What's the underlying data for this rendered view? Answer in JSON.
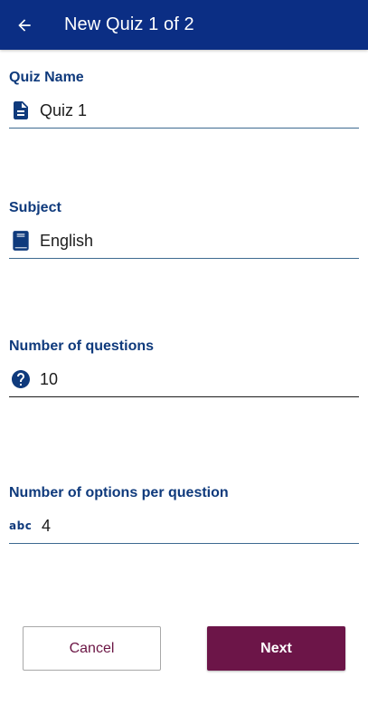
{
  "appbar": {
    "title": "New Quiz 1 of 2",
    "back_icon": "arrow-left-icon"
  },
  "fields": {
    "quiz_name": {
      "label": "Quiz Name",
      "value": "Quiz 1",
      "icon": "document-icon"
    },
    "subject": {
      "label": "Subject",
      "value": "English",
      "icon": "book-icon"
    },
    "num_questions": {
      "label": "Number of questions",
      "value": "10",
      "icon": "question-circle-icon"
    },
    "num_options": {
      "label": "Number of options per question",
      "value": "4",
      "icon": "abc-icon",
      "icon_text": "abc"
    }
  },
  "buttons": {
    "cancel": "Cancel",
    "next": "Next"
  },
  "colors": {
    "appbar": "#0b2e84",
    "label": "#0f3a7c",
    "accent": "#6c1548"
  }
}
